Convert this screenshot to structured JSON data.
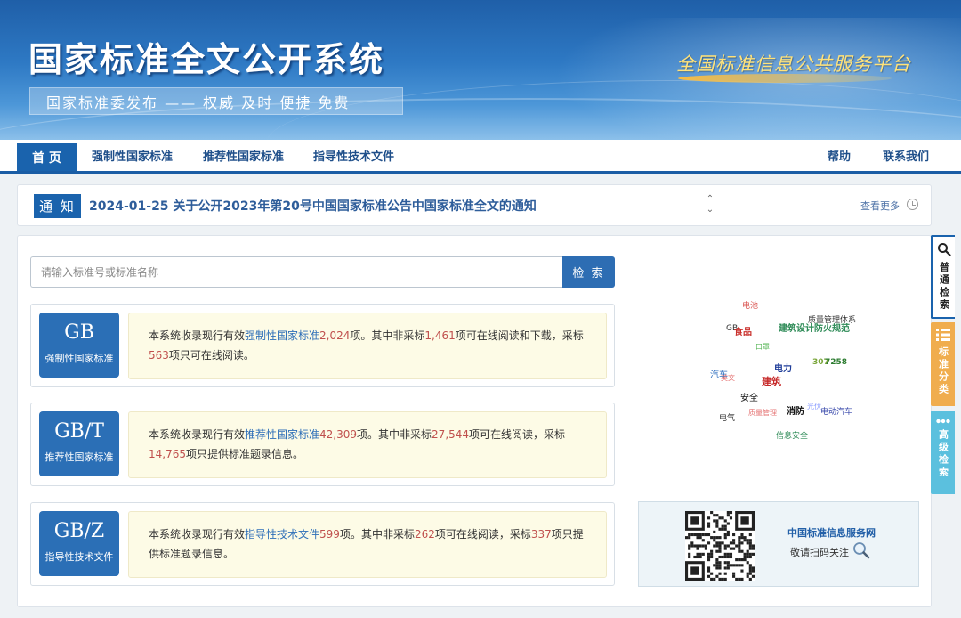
{
  "header": {
    "site_title": "国家标准全文公开系统",
    "subtitle": "国家标准委发布 —— 权威 及时 便捷 免费",
    "platform": "全国标准信息公共服务平台"
  },
  "nav": {
    "home": "首 页",
    "mandatory": "强制性国家标准",
    "recommended": "推荐性国家标准",
    "guidance": "指导性技术文件",
    "help": "帮助",
    "contact": "联系我们"
  },
  "notice": {
    "tag": "通 知",
    "text": "2024-01-25  关于公开2023年第20号中国国家标准公告中国家标准全文的通知",
    "more": "查看更多"
  },
  "search": {
    "placeholder": "请输入标准号或标准名称",
    "button": "检 索"
  },
  "standards": [
    {
      "code": "GB",
      "label": "强制性国家标准",
      "p1": "本系统收录现行有效",
      "type": "强制性国家标准",
      "total": "2,024",
      "p2": "项。其中非采标",
      "nonadopted": "1,461",
      "p3": "项可在线阅读和下载，采标",
      "adopted": "563",
      "p4": "项只可在线阅读。"
    },
    {
      "code": "GB/T",
      "label": "推荐性国家标准",
      "p1": "本系统收录现行有效",
      "type": "推荐性国家标准",
      "total": "42,309",
      "p2": "项。其中非采标",
      "nonadopted": "27,544",
      "p3": "项可在线阅读，采标",
      "adopted": "14,765",
      "p4": "项只提供标准题录信息。"
    },
    {
      "code": "GB/Z",
      "label": "指导性技术文件",
      "p1": "本系统收录现行有效",
      "type": "指导性技术文件",
      "total": "599",
      "p2": "项。其中非采标",
      "nonadopted": "262",
      "p3": "项可在线阅读，采标",
      "adopted": "337",
      "p4": "项只提供标准题录信息。"
    }
  ],
  "word_cloud": [
    {
      "text": "电池",
      "color": "#d9534f"
    },
    {
      "text": "质量管理体系",
      "color": "#333333"
    },
    {
      "text": "GB",
      "color": "#333333"
    },
    {
      "text": "食品",
      "color": "#c9302c"
    },
    {
      "text": "建筑设计防火规范",
      "color": "#2e8b57"
    },
    {
      "text": "口罩",
      "color": "#5cb85c"
    },
    {
      "text": "电力",
      "color": "#1f3d99"
    },
    {
      "text": "307",
      "color": "#7aa63a"
    },
    {
      "text": "7258",
      "color": "#2e7d32"
    },
    {
      "text": "汽车",
      "color": "#2f6fbf"
    },
    {
      "text": "英文",
      "color": "#e57373"
    },
    {
      "text": "建筑",
      "color": "#c62828"
    },
    {
      "text": "安全",
      "color": "#111111"
    },
    {
      "text": "消防",
      "color": "#111111"
    },
    {
      "text": "光伏",
      "color": "#8c9eff"
    },
    {
      "text": "电动汽车",
      "color": "#3949ab"
    },
    {
      "text": "电气",
      "color": "#333333"
    },
    {
      "text": "质量管理",
      "color": "#e57373"
    },
    {
      "text": "信息安全",
      "color": "#2e8b57"
    }
  ],
  "qr": {
    "site": "中国标准信息服务网",
    "tip": "敬请扫码关注"
  },
  "side_tabs": {
    "normal": "普通检索",
    "category": "标准分类",
    "advanced": "高级检索"
  }
}
